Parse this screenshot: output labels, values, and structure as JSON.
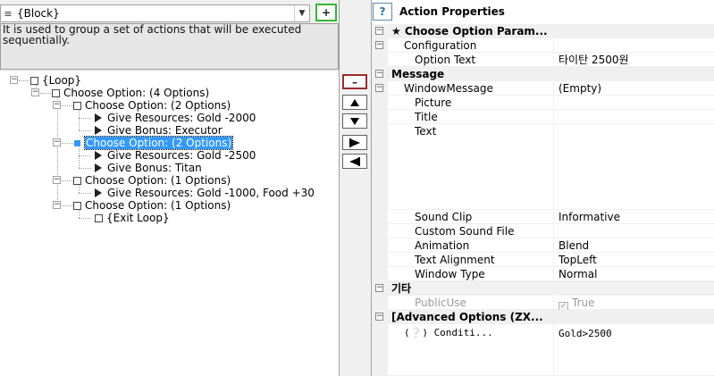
{
  "block_select": {
    "value": "{Block}",
    "add_label": "+"
  },
  "description": "It is used to group a set of actions that will be executed sequentially.",
  "tree": {
    "loop": "{Loop}",
    "choose_root": "Choose Option: (4 Options)",
    "opt1": "Choose Option: (2 Options)",
    "opt1_a": "Give Resources: Gold -2000",
    "opt1_b": "Give Bonus: Executor",
    "opt2": "Choose Option: (2 Options)",
    "opt2_a": "Give Resources: Gold -2500",
    "opt2_b": "Give Bonus: Titan",
    "opt3": "Choose Option: (1 Options)",
    "opt3_a": "Give Resources: Gold -1000, Food +30",
    "opt4": "Choose Option: (1 Options)",
    "opt4_a": "{Exit Loop}"
  },
  "toolbar": {
    "remove_label": "–"
  },
  "properties": {
    "help_label": "?",
    "title": "Action Properties",
    "cat_choose": "★ Choose Option Param...",
    "configuration": "Configuration",
    "option_text_label": "Option Text",
    "option_text_value": "타이탄 2500원",
    "cat_message": "Message",
    "window_message": "WindowMessage",
    "window_message_value": "(Empty)",
    "picture": "Picture",
    "title_field": "Title",
    "text_field": "Text",
    "sound_clip": "Sound Clip",
    "sound_clip_value": "Informative",
    "custom_sound": "Custom Sound File",
    "animation": "Animation",
    "animation_value": "Blend",
    "text_alignment": "Text Alignment",
    "text_alignment_value": "TopLeft",
    "window_type": "Window Type",
    "window_type_value": "Normal",
    "cat_etc": "기타",
    "public_use": "PublicUse",
    "public_use_value": "True",
    "cat_advanced": "[Advanced Options (ZX...",
    "condition_label": "(❔) Conditi...",
    "condition_value": "Gold>2500"
  }
}
